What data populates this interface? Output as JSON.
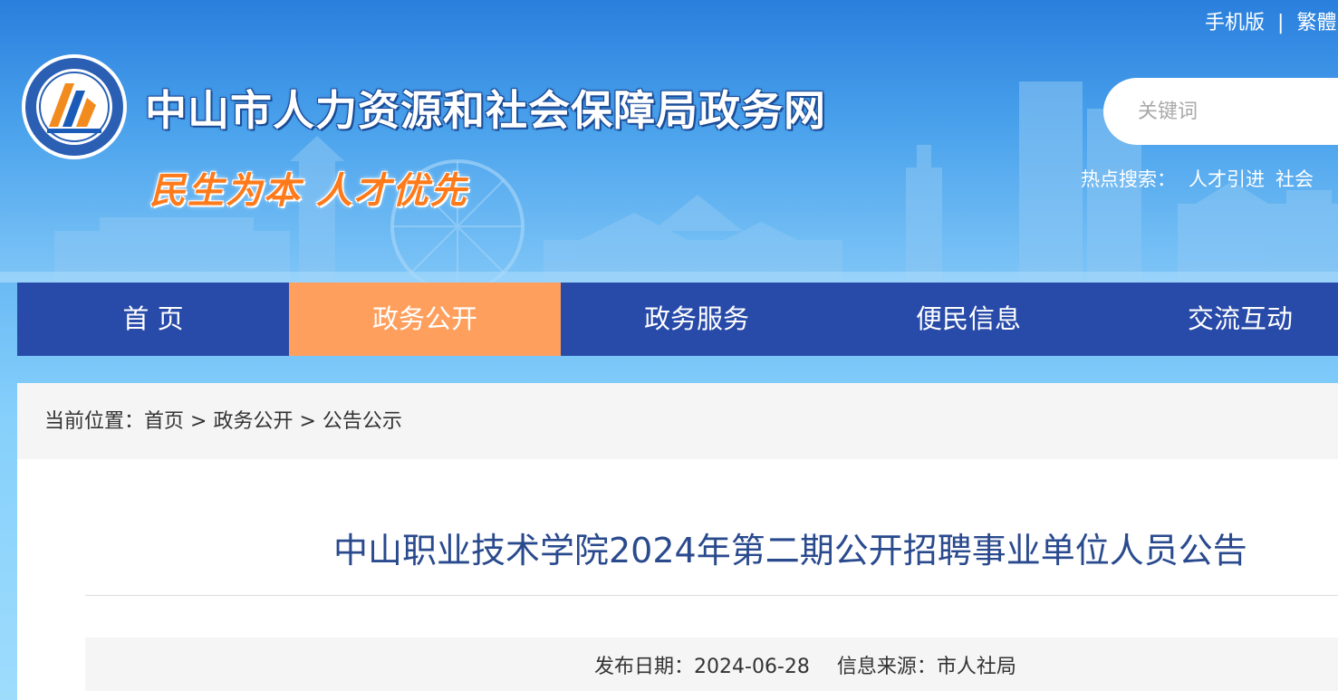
{
  "header": {
    "top_links": {
      "mobile": "手机版",
      "separator": "|",
      "traditional": "繁體"
    },
    "site_title": "中山市人力资源和社会保障局政务网",
    "slogan": "民生为本 人才优先",
    "search": {
      "placeholder": "关键词"
    },
    "hot_search": {
      "label": "热点搜索：",
      "items": [
        "人才引进",
        "社会"
      ]
    }
  },
  "nav": {
    "items": [
      {
        "label": "首 页",
        "active": false
      },
      {
        "label": "政务公开",
        "active": true
      },
      {
        "label": "政务服务",
        "active": false
      },
      {
        "label": "便民信息",
        "active": false
      },
      {
        "label": "交流互动",
        "active": false
      }
    ]
  },
  "breadcrumb": {
    "prefix": "当前位置：",
    "items": [
      "首页",
      "政务公开",
      "公告公示"
    ],
    "separator": ">"
  },
  "article": {
    "title": "中山职业技术学院2024年第二期公开招聘事业单位人员公告",
    "meta": {
      "date_label": "发布日期：",
      "date": "2024-06-28",
      "source_label": "信息来源：",
      "source": "市人社局"
    }
  },
  "colors": {
    "nav_bg": "#284aa8",
    "nav_active": "#ff9f5e",
    "title_color": "#2a4a8e",
    "slogan_color": "#ff7a1a"
  },
  "icons": {
    "logo": "bureau-emblem-logo"
  }
}
